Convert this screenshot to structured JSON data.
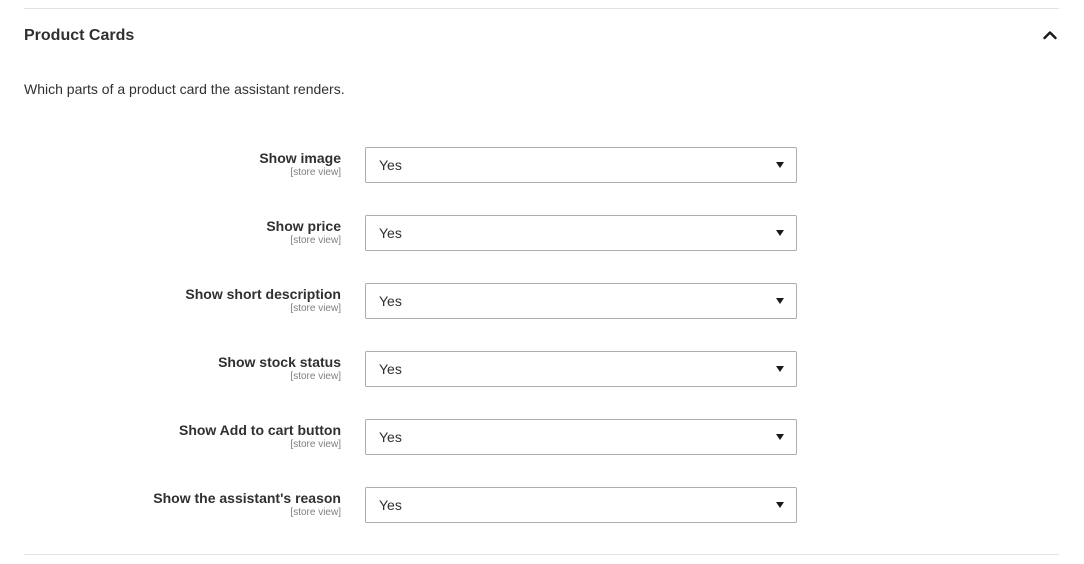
{
  "section": {
    "title": "Product Cards",
    "description": "Which parts of a product card the assistant renders.",
    "toggle_icon": "chevron-up-icon"
  },
  "fields": [
    {
      "label": "Show image",
      "scope": "[store view]",
      "value": "Yes"
    },
    {
      "label": "Show price",
      "scope": "[store view]",
      "value": "Yes"
    },
    {
      "label": "Show short description",
      "scope": "[store view]",
      "value": "Yes"
    },
    {
      "label": "Show stock status",
      "scope": "[store view]",
      "value": "Yes"
    },
    {
      "label": "Show Add to cart button",
      "scope": "[store view]",
      "value": "Yes"
    },
    {
      "label": "Show the assistant's reason",
      "scope": "[store view]",
      "value": "Yes"
    }
  ],
  "colors": {
    "text": "#303030",
    "scope_text": "#808080",
    "border": "#adadad",
    "divider": "#e3e3e3"
  }
}
